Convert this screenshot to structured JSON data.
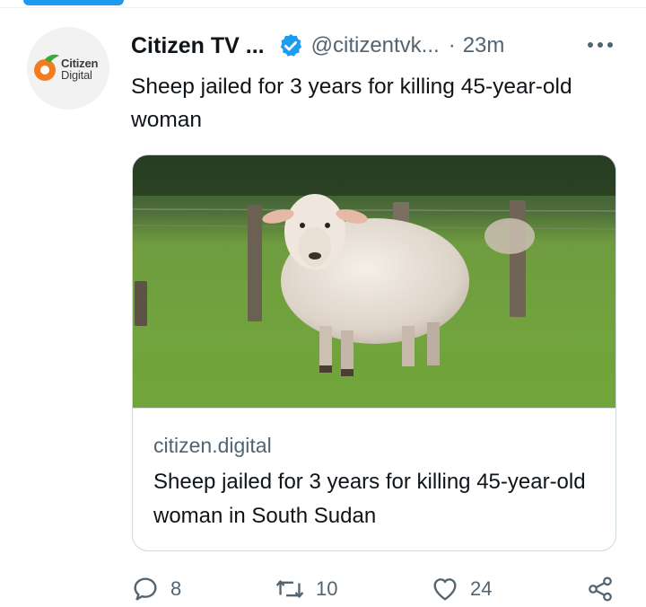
{
  "tweet": {
    "display_name": "Citizen TV ...",
    "handle": "@citizentvk...",
    "separator": "·",
    "time": "23m",
    "text": "Sheep jailed for 3 years for killing 45-year-old woman",
    "avatar": {
      "line1": "Citizen",
      "line2": "Digital",
      "accent": "#f47b20",
      "green": "#3aa935"
    }
  },
  "card": {
    "domain": "citizen.digital",
    "title": "Sheep jailed for 3 years for killing 45-year-old woman in South Sudan"
  },
  "actions": {
    "replies": "8",
    "retweets": "10",
    "likes": "24"
  },
  "colors": {
    "verified": "#1d9bf0",
    "text": "#0f1419",
    "secondary": "#536471",
    "border": "#cfd9de"
  }
}
